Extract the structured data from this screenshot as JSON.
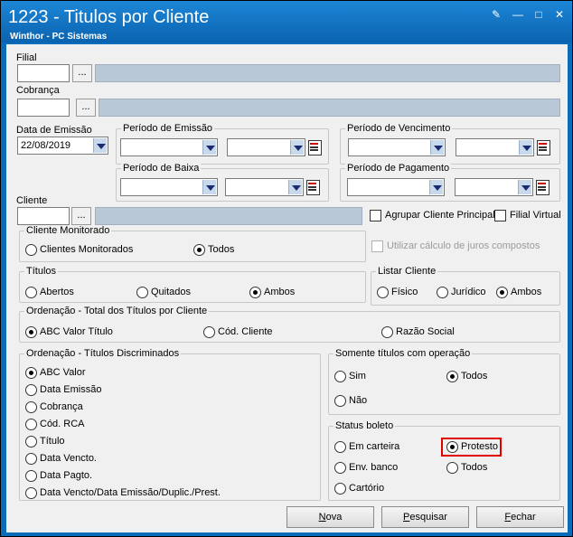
{
  "window": {
    "title": "1223 - Titulos por Cliente",
    "subtitle": "Winthor - PC Sistemas"
  },
  "fields": {
    "filial_label": "Filial",
    "cobranca_label": "Cobrança",
    "data_emissao_label": "Data de Emissão",
    "data_emissao_value": "22/08/2019",
    "cliente_label": "Cliente",
    "lookup_button": "..."
  },
  "periodos": {
    "emissao": "Período de Emissão",
    "vencimento": "Período de Vencimento",
    "baixa": "Período de Baixa",
    "pagamento": "Período de Pagamento"
  },
  "checkboxes": {
    "agrupar": "Agrupar Cliente Principal",
    "filial_virtual": "Filial Virtual",
    "juros": "Utilizar cálculo de juros compostos"
  },
  "groups": {
    "cliente_monitorado": {
      "title": "Cliente Monitorado",
      "options": [
        "Clientes Monitorados",
        "Todos"
      ],
      "selected": 1
    },
    "titulos": {
      "title": "Títulos",
      "options": [
        "Abertos",
        "Quitados",
        "Ambos"
      ],
      "selected": 2
    },
    "listar_cliente": {
      "title": "Listar Cliente",
      "options": [
        "Físico",
        "Jurídico",
        "Ambos"
      ],
      "selected": 2
    },
    "ordenacao_total": {
      "title": "Ordenação - Total dos Títulos por Cliente",
      "options": [
        "ABC Valor Título",
        "Cód. Cliente",
        "Razão Social"
      ],
      "selected": 0
    },
    "ordenacao_disc": {
      "title": "Ordenação - Títulos Discriminados",
      "options": [
        "ABC Valor",
        "Data Emissão",
        "Cobrança",
        "Cód. RCA",
        "Título",
        "Data Vencto.",
        "Data Pagto.",
        "Data Vencto/Data Emissão/Duplic./Prest."
      ],
      "selected": 0
    },
    "somente": {
      "title": "Somente títulos com operação",
      "options": [
        "Sim",
        "Todos",
        "Não"
      ],
      "selected": 1
    },
    "status_boleto": {
      "title": "Status boleto",
      "options": [
        "Em carteira",
        "Protesto",
        "Env. banco",
        "Todos",
        "Cartório"
      ],
      "selected": 1
    }
  },
  "buttons": {
    "nova_u": "N",
    "nova_rest": "ova",
    "pesquisar_u": "P",
    "pesquisar_rest": "esquisar",
    "fechar_u": "F",
    "fechar_rest": "echar"
  },
  "colors": {
    "title_bar": "#0a6bb8",
    "highlight": "#e00000"
  }
}
